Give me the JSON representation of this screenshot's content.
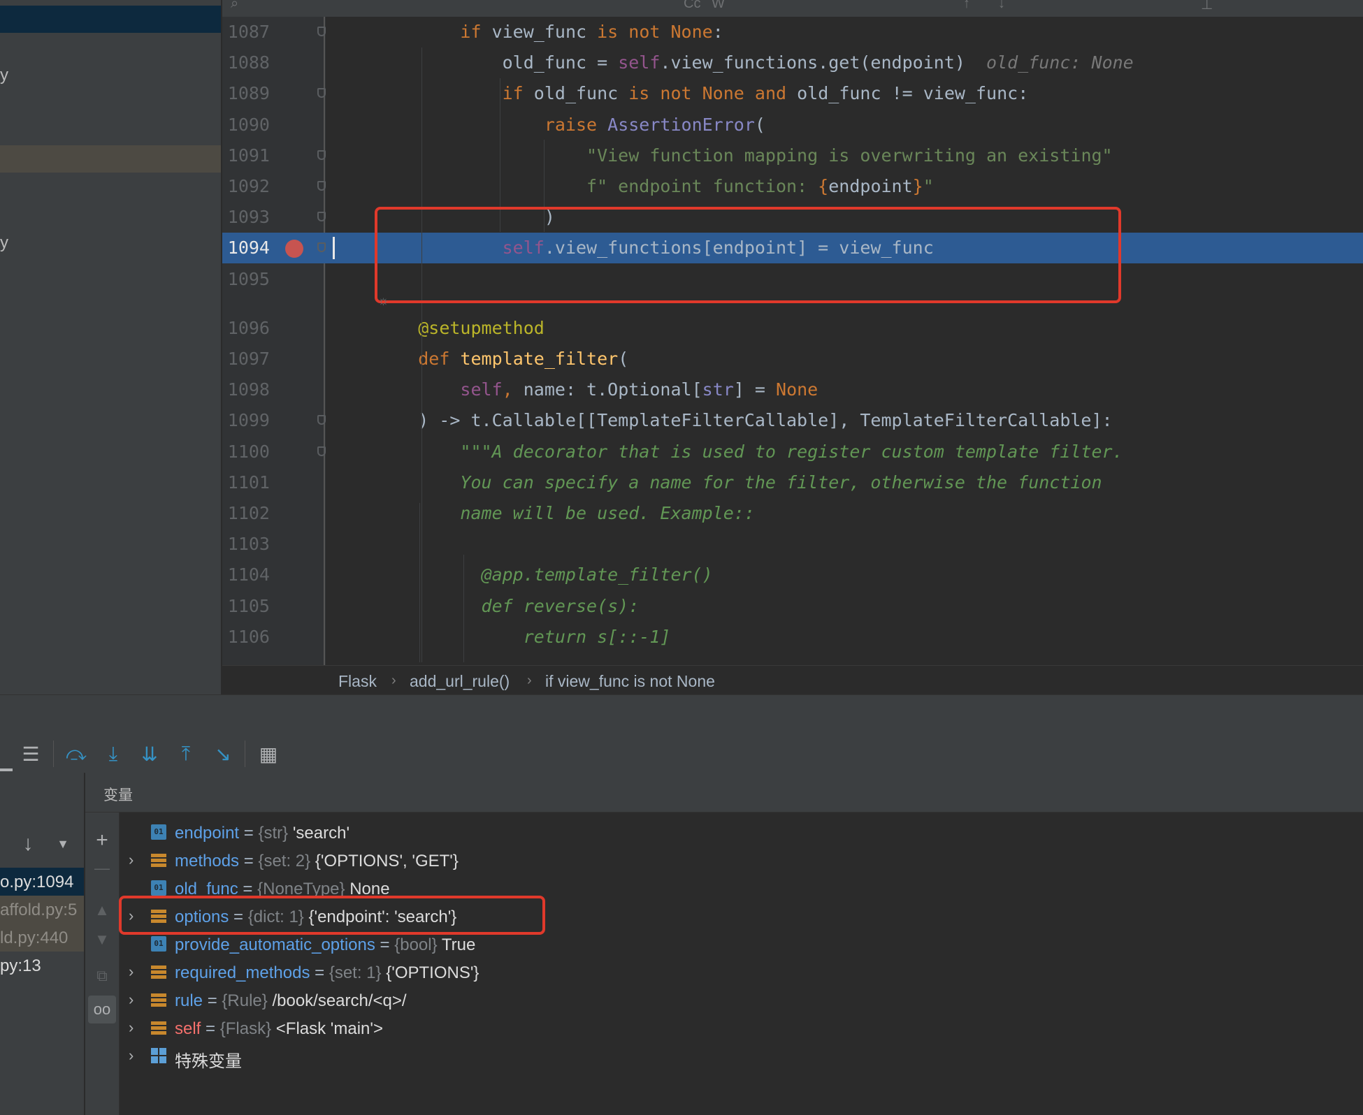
{
  "project_tree": {
    "fragments": [
      "y",
      "y"
    ]
  },
  "editor": {
    "lines": [
      {
        "n": "1087",
        "code": "        <span class=\"kw\">if</span> view_func <span class=\"kw\">is not</span> <span class=\"kw\">None</span>:"
      },
      {
        "n": "1088",
        "code": "            old_func = <span class=\"self\">self</span>.view_functions.get(endpoint)  <span class=\"inlay\">old_func: None</span>"
      },
      {
        "n": "1089",
        "code": "            <span class=\"kw\">if</span> old_func <span class=\"kw\">is not</span> <span class=\"kw\">None</span> <span class=\"kw\">and</span> old_func != view_func:"
      },
      {
        "n": "1090",
        "code": "                <span class=\"kw\">raise</span> <span style=\"color:#8888c6\">AssertionError</span>("
      },
      {
        "n": "1091",
        "code": "                    <span class=\"str\">\"View function mapping is overwriting an existing\"</span>"
      },
      {
        "n": "1092",
        "code": "                    <span class=\"str\">f\" endpoint function: </span><span class=\"brace\">{</span>endpoint<span class=\"brace\">}</span><span class=\"str\">\"</span>"
      },
      {
        "n": "1093",
        "code": "                )"
      },
      {
        "n": "1094",
        "code": "            <span class=\"self\">self</span>.view_functions[endpoint] = view_func"
      },
      {
        "n": "1095",
        "code": ""
      },
      {
        "n": "1096",
        "code": "    <span class=\"dec\">@setupmethod</span>"
      },
      {
        "n": "1097",
        "code": "    <span class=\"kw\">def</span> <span class=\"fn\">template_filter</span>("
      },
      {
        "n": "1098",
        "code": "        <span class=\"self\">self</span><span class=\"kw\">,</span> name: t.Optional[<span style=\"color:#8888c6\">str</span>] = <span class=\"kw\">None</span>"
      },
      {
        "n": "1099",
        "code": "    ) -> t.Callable[[TemplateFilterCallable], TemplateFilterCallable]:"
      },
      {
        "n": "1100",
        "code": "        <span class=\"doc\">\"\"\"A decorator that is used to register custom template filter.</span>"
      },
      {
        "n": "1101",
        "code": "        <span class=\"doc\">You can specify a name for the filter, otherwise the function</span>"
      },
      {
        "n": "1102",
        "code": "        <span class=\"doc\">name will be used. Example::</span>"
      },
      {
        "n": "1103",
        "code": ""
      },
      {
        "n": "1104",
        "code": "          <span class=\"doc\">@app.template_filter()</span>"
      },
      {
        "n": "1105",
        "code": "          <span class=\"doc\">def reverse(s):</span>"
      },
      {
        "n": "1106",
        "code": "              <span class=\"doc\">return s[::-1]</span>"
      }
    ],
    "current_line": "1094",
    "breakpoint_line": "1094"
  },
  "breadcrumb": {
    "items": [
      "Flask",
      "add_url_rule()",
      "if view_func is not None"
    ]
  },
  "frames": [
    {
      "text": "o.py:1094",
      "state": "selected"
    },
    {
      "text": "affold.py:5",
      "state": "lib"
    },
    {
      "text": "ld.py:440",
      "state": "lib"
    },
    {
      "text": "py:13",
      "state": "normal"
    }
  ],
  "variables": {
    "header": "变量",
    "items": [
      {
        "name": "endpoint",
        "type": "{str}",
        "value": "'search'",
        "icon": "primitive",
        "expandable": false
      },
      {
        "name": "methods",
        "type": "{set: 2}",
        "value": "{'OPTIONS', 'GET'}",
        "icon": "collection",
        "expandable": true
      },
      {
        "name": "old_func",
        "type": "{NoneType}",
        "value": "None",
        "icon": "primitive",
        "expandable": false
      },
      {
        "name": "options",
        "type": "{dict: 1}",
        "value": "{'endpoint': 'search'}",
        "icon": "collection",
        "expandable": true
      },
      {
        "name": "provide_automatic_options",
        "type": "{bool}",
        "value": "True",
        "icon": "primitive",
        "expandable": false
      },
      {
        "name": "required_methods",
        "type": "{set: 1}",
        "value": "{'OPTIONS'}",
        "icon": "collection",
        "expandable": true
      },
      {
        "name": "rule",
        "type": "{Rule}",
        "value": "/book/search/<q>/",
        "icon": "collection",
        "expandable": true
      },
      {
        "name": "self",
        "type": "{Flask}",
        "value": "<Flask 'main'>",
        "icon": "collection",
        "expandable": true
      },
      {
        "name": "特殊变量",
        "type": "",
        "value": "",
        "icon": "special",
        "expandable": true
      }
    ]
  }
}
